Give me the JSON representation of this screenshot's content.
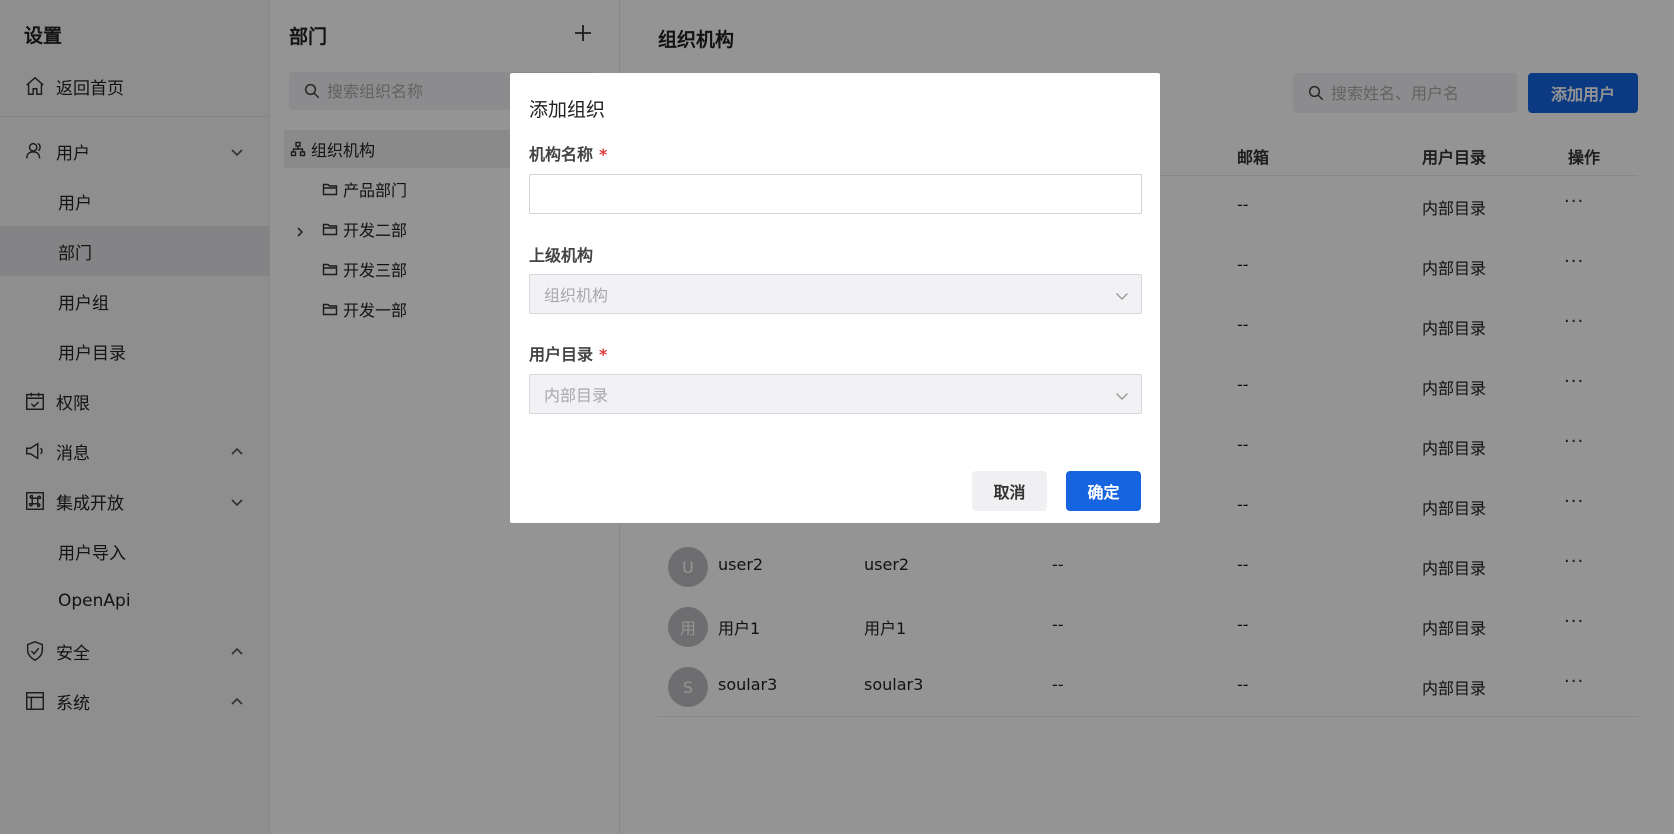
{
  "sidebar": {
    "title": "设置",
    "home": "返回首页",
    "items": [
      {
        "label": "用户",
        "icon": "users-icon"
      },
      {
        "label": "权限",
        "icon": "calendar-check-icon"
      },
      {
        "label": "消息",
        "icon": "megaphone-icon"
      },
      {
        "label": "集成开放",
        "icon": "command-icon"
      },
      {
        "label": "安全",
        "icon": "shield-icon"
      },
      {
        "label": "系统",
        "icon": "layout-icon"
      }
    ],
    "user_sub": [
      "用户",
      "部门",
      "用户组",
      "用户目录"
    ],
    "integration_sub": [
      "用户导入",
      "OpenApi"
    ]
  },
  "dept": {
    "title": "部门",
    "search_placeholder": "搜索组织名称",
    "root": "组织机构",
    "children": [
      "产品部门",
      "开发二部",
      "开发三部",
      "开发一部"
    ]
  },
  "main": {
    "title": "组织机构",
    "search_placeholder": "搜索姓名、用户名",
    "add_user": "添加用户",
    "columns": {
      "email": "邮箱",
      "directory": "用户目录",
      "actions": "操作"
    },
    "hidden_rows": [
      {
        "email": "--",
        "directory": "内部目录",
        "more": "···"
      },
      {
        "email": "--",
        "directory": "内部目录",
        "more": "···"
      },
      {
        "email": "--",
        "directory": "内部目录",
        "more": "···"
      },
      {
        "email": "--",
        "directory": "内部目录",
        "more": "···"
      },
      {
        "email": "--",
        "directory": "内部目录",
        "more": "···"
      },
      {
        "email": "--",
        "directory": "内部目录",
        "more": "···"
      }
    ],
    "rows": [
      {
        "avatar": "U",
        "name": "user2",
        "username": "user2",
        "phone": "--",
        "email": "--",
        "directory": "内部目录",
        "more": "···"
      },
      {
        "avatar": "用",
        "name": "用户1",
        "username": "用户1",
        "phone": "--",
        "email": "--",
        "directory": "内部目录",
        "more": "···"
      },
      {
        "avatar": "S",
        "name": "soular3",
        "username": "soular3",
        "phone": "--",
        "email": "--",
        "directory": "内部目录",
        "more": "···"
      }
    ]
  },
  "modal": {
    "title": "添加组织",
    "name_label": "机构名称",
    "name_value": "",
    "required_mark": "*",
    "parent_label": "上级机构",
    "parent_value": "组织机构",
    "directory_label": "用户目录",
    "directory_value": "内部目录",
    "cancel": "取消",
    "ok": "确定"
  },
  "colors": {
    "primary": "#1664e0",
    "required": "#e23b3b",
    "mask": "rgba(0,0,0,0.42)"
  }
}
